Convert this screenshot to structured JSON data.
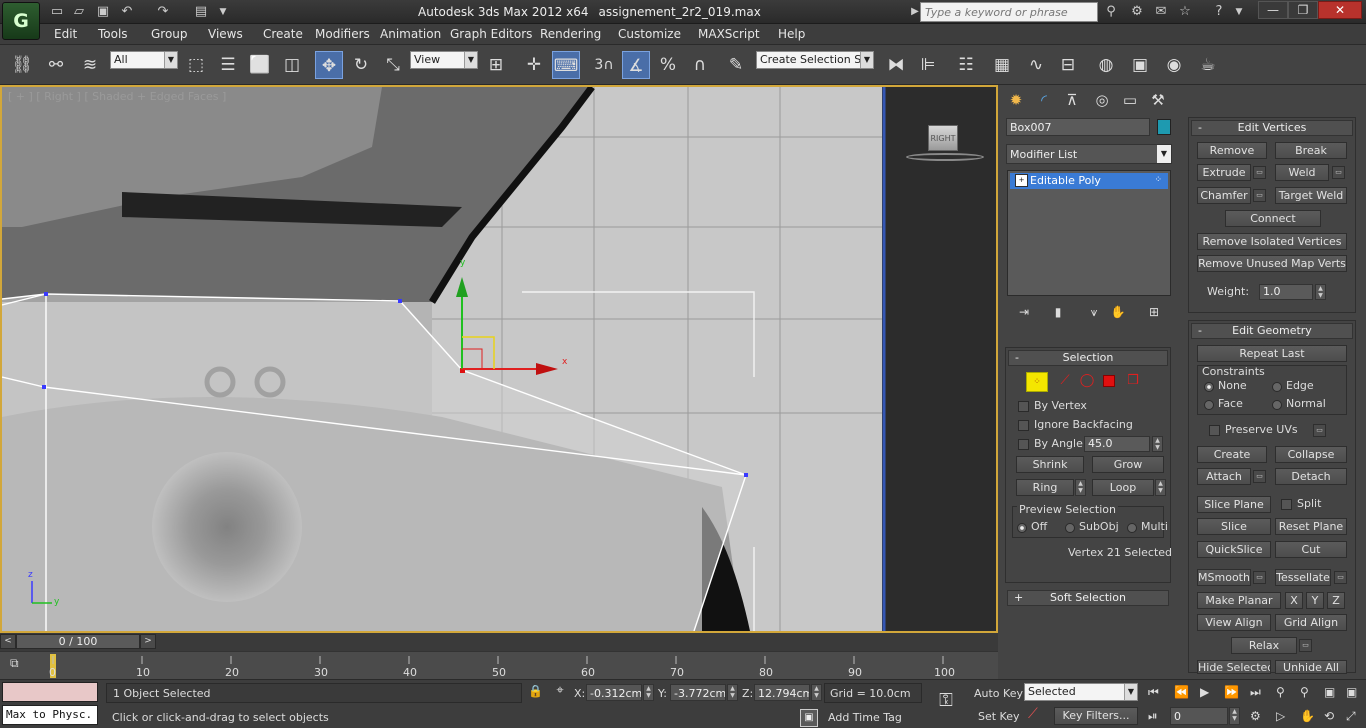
{
  "window": {
    "title_app": "Autodesk 3ds Max  2012 x64",
    "title_file": "assignement_2r2_019.max",
    "logo": "G"
  },
  "search": {
    "placeholder": "Type a keyword or phrase"
  },
  "menu": [
    "Edit",
    "Tools",
    "Group",
    "Views",
    "Create",
    "Modifiers",
    "Animation",
    "Graph Editors",
    "Rendering",
    "Customize",
    "MAXScript",
    "Help"
  ],
  "toolbar": {
    "filter": "All",
    "ref_coord": "View",
    "snap_count": "3",
    "selection_set": "Create Selection Se"
  },
  "viewport": {
    "label": "[ + ] [ Right ] [ Shaded + Edged Faces ]",
    "viewcube": "RIGHT",
    "gizmo_x": "x",
    "gizmo_y": "y",
    "axis_x": "y",
    "axis_z": "z"
  },
  "panel": {
    "object_name": "Box007",
    "object_color": "#1e9ab0",
    "modifier_list": "Modifier List",
    "stack_item": "Editable Poly",
    "edit_vertices": {
      "title": "Edit Vertices",
      "remove": "Remove",
      "break": "Break",
      "extrude": "Extrude",
      "weld": "Weld",
      "chamfer": "Chamfer",
      "target_weld": "Target Weld",
      "connect": "Connect",
      "remove_isolated": "Remove Isolated Vertices",
      "remove_unused": "Remove Unused Map Verts",
      "weight_label": "Weight:",
      "weight_value": "1.0"
    },
    "edit_geometry": {
      "title": "Edit Geometry",
      "repeat_last": "Repeat Last",
      "constraints": "Constraints",
      "none": "None",
      "edge": "Edge",
      "face": "Face",
      "normal": "Normal",
      "preserve_uvs": "Preserve UVs",
      "create": "Create",
      "collapse": "Collapse",
      "attach": "Attach",
      "detach": "Detach",
      "slice_plane": "Slice Plane",
      "split": "Split",
      "slice": "Slice",
      "reset_plane": "Reset Plane",
      "quickslice": "QuickSlice",
      "cut": "Cut",
      "msmooth": "MSmooth",
      "tessellate": "Tessellate",
      "make_planar": "Make Planar",
      "x": "X",
      "y": "Y",
      "z": "Z",
      "view_align": "View Align",
      "grid_align": "Grid Align",
      "relax": "Relax",
      "hide_selected": "Hide Selected",
      "unhide_all": "Unhide All"
    },
    "selection": {
      "title": "Selection",
      "by_vertex": "By Vertex",
      "ignore_backfacing": "Ignore Backfacing",
      "by_angle": "By Angle:",
      "angle_value": "45.0",
      "shrink": "Shrink",
      "grow": "Grow",
      "ring": "Ring",
      "loop": "Loop",
      "preview": "Preview Selection",
      "off": "Off",
      "subobj": "SubObj",
      "multi": "Multi",
      "status": "Vertex 21 Selected"
    },
    "soft_selection": {
      "title": "Soft Selection"
    }
  },
  "timeline": {
    "frame": "0 / 100",
    "ticks": [
      "0",
      "10",
      "20",
      "30",
      "40",
      "50",
      "60",
      "70",
      "80",
      "90",
      "100"
    ]
  },
  "status": {
    "script_label": "Max to Physc.",
    "objects": "1 Object Selected",
    "prompt": "Click or click-and-drag to select objects",
    "x_label": "X:",
    "x_value": "-0.312cm",
    "y_label": "Y:",
    "y_value": "-3.772cm",
    "z_label": "Z:",
    "z_value": "12.794cm",
    "grid": "Grid = 10.0cm",
    "add_time_tag": "Add Time Tag",
    "auto_key": "Auto Key",
    "set_key": "Set Key",
    "key_mode": "Selected",
    "key_filters": "Key Filters...",
    "current_frame": "0"
  }
}
